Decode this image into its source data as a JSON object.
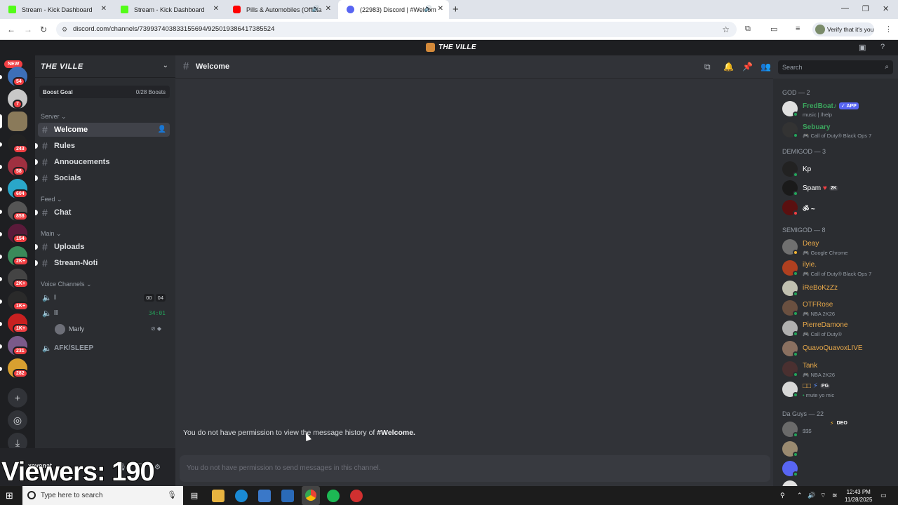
{
  "browser": {
    "tabs": [
      {
        "title": "Stream - Kick Dashboard",
        "color": "#53fc18"
      },
      {
        "title": "Stream - Kick Dashboard",
        "color": "#53fc18"
      },
      {
        "title": "Pills & Automobiles (Officia",
        "color": "#ff0000"
      },
      {
        "title": "(22983) Discord | #Welcom",
        "color": "#5865f2"
      }
    ],
    "url": "discord.com/channels/739937403833155694/925019386417385524",
    "verify_label": "Verify that it's you"
  },
  "discord": {
    "server_name": "THE VILLE",
    "guild_new_label": "NEW",
    "guild_badges": [
      "54",
      "7",
      "243",
      "58",
      "604",
      "858",
      "154",
      "2K+",
      "2K+",
      "1K+",
      "1K+",
      "231",
      "282"
    ],
    "boost": {
      "label": "Boost Goal",
      "count": "0/28 Boosts"
    },
    "categories": {
      "server": "Server",
      "feed": "Feed",
      "main": "Main",
      "voice": "Voice Channels"
    },
    "channels": {
      "welcome": "Welcome",
      "rules": "Rules",
      "annoucements": "Annoucements",
      "socials": "Socials",
      "chat": "Chat",
      "uploads": "Uploads",
      "stream_noti": "Stream-Noti"
    },
    "voice": {
      "ch1": "I",
      "ch1_count_a": "00",
      "ch1_count_b": "04",
      "ch2": "II",
      "ch2_time": "34:01",
      "user": "Marly",
      "afk": "AFK/SLEEP"
    },
    "user_panel": {
      "username": "xevonat"
    },
    "stream_overlay": "Viewers: 190",
    "chat": {
      "channel": "Welcome",
      "search_placeholder": "Search",
      "no_history_prefix": "You do not have permission to view the message history of",
      "no_history_channel": "#Welcome.",
      "composer_placeholder": "You do not have permission to send messages in this channel."
    },
    "members": {
      "god": "GOD — 2",
      "demigod": "DEMIGOD — 3",
      "semigod": "SEMIGOD — 8",
      "daguys": "Da Guys — 22",
      "list": {
        "fredboat": {
          "name": "FredBoat♪",
          "tag": "✓ APP",
          "sub": "music | /help"
        },
        "sebuary": {
          "name": "Sebuary",
          "sub": "Call of Duty® Black Ops 7"
        },
        "kp": {
          "name": "Kp"
        },
        "spam": {
          "name": "Spam",
          "tag": "2K"
        },
        "om": {
          "name": "ॐ ~"
        },
        "deay": {
          "name": "Deay",
          "sub": "Google Chrome"
        },
        "ilyie": {
          "name": "ilyie.",
          "sub": "Call of Duty® Black Ops 7"
        },
        "irebokzzz": {
          "name": "iReBoKzZz"
        },
        "otfrose": {
          "name": "OTFRose",
          "sub": "NBA 2K26"
        },
        "pierre": {
          "name": "PierreDamone",
          "sub": "Call of Duty®"
        },
        "quavo": {
          "name": "QuavoQuavoxLIVE"
        },
        "tank": {
          "name": "Tank",
          "sub": "NBA 2K26"
        },
        "boxes": {
          "name": "□□",
          "tag": "PG",
          "sub": "mute yo mic"
        },
        "dollars": {
          "name": "",
          "sub": "$$$",
          "tag": "DEO"
        }
      }
    }
  },
  "taskbar": {
    "search_placeholder": "Type here to search",
    "time": "12:43 PM",
    "date": "11/28/2025"
  },
  "colors": {
    "discord_bg": "#313338",
    "sidebar_bg": "#2b2d31",
    "guild_bg": "#1e1f22",
    "online": "#23a55a",
    "dnd": "#f23f43",
    "god_name": "#3ba55d",
    "semigod_name": "#e8a94a"
  }
}
